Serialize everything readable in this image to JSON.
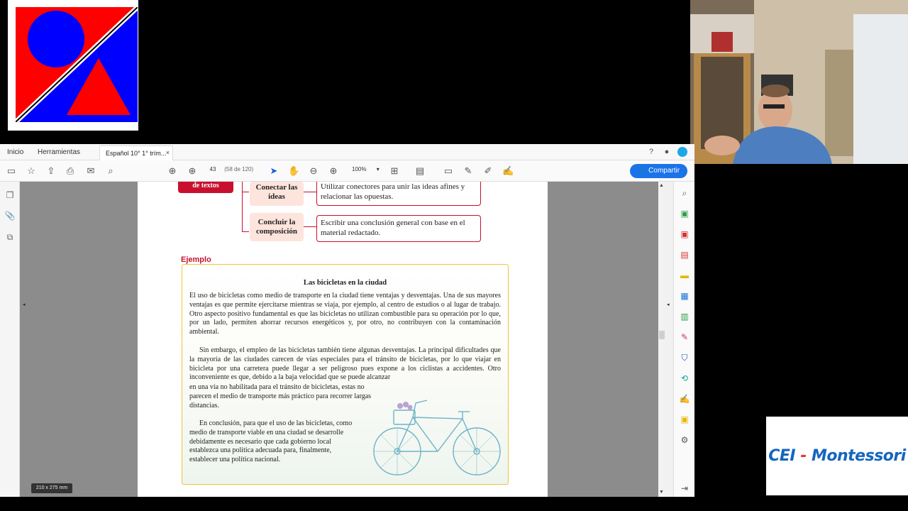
{
  "logo": {
    "name": "shapes-logo"
  },
  "webcam": {
    "description_hidden": ""
  },
  "montessori": {
    "cei": "CEI",
    "sep": " - ",
    "name": "Montessori"
  },
  "menubar": {
    "inicio": "Inicio",
    "herramientas": "Herramientas",
    "tab_title": "Español 10° 1° trím...",
    "tab_close": "×"
  },
  "toolbar": {
    "page_current": "43",
    "page_of": "(58 de 120)",
    "zoom": "100%",
    "share_label": "Compartir"
  },
  "document": {
    "red_label": "de textos",
    "steps": [
      {
        "label": "Conectar las ideas",
        "desc": "Utilizar conectores para unir las ideas afines y relacionar las opuestas."
      },
      {
        "label": "Concluir la composición",
        "desc": "Escribir una conclusión general con base en el material redactado."
      }
    ],
    "ejemplo": "Ejemplo",
    "title": "Las bicicletas en la ciudad",
    "para1": "El uso de bicicletas como medio de transporte en la ciudad tiene ventajas y desventajas. Una de sus mayores ventajas es que permite ejercitarse mientras se viaja, por ejemplo, al centro de estudios o al lugar de trabajo. Otro aspecto positivo fundamental es que las bicicletas no utilizan combustible para su operación por lo que, por un lado, permiten ahorrar recursos energéticos y, por otro, no contribuyen con la contaminación ambiental.",
    "para2a": "Sin embargo, el empleo de las bicicletas también tiene algunas desventajas. La principal dificultades que la mayoría de las ciudades carecen de vías especiales para el tránsito de bicicletas, por lo que viajar en bicicleta por una carretera puede llegar a ser peligroso pues expone a los ciclistas a accidentes. Otro inconveniente es que, debido a la baja velocidad que se puede alcanzar",
    "para2b": "en una vía no habilitada para el tránsito de bicicletas, estas no parecen el medio de transporte más práctico para recorrer largas distancias.",
    "para3": "En conclusión, para que el uso de las bicicletas, como medio de transporte viable en una ciudad se desarrolle debidamente es necesario que cada gobierno local establezca una política adecuada para, finalmente, establecer una política nacional."
  },
  "size_chip": "210 x 275 mm"
}
